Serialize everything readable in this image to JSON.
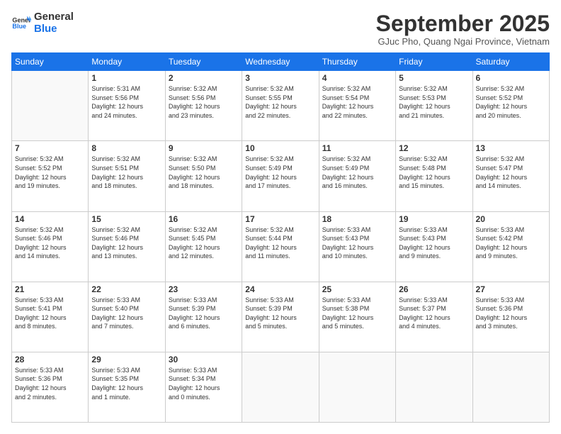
{
  "logo": {
    "general": "General",
    "blue": "Blue"
  },
  "header": {
    "month": "September 2025",
    "location": "GJuc Pho, Quang Ngai Province, Vietnam"
  },
  "weekdays": [
    "Sunday",
    "Monday",
    "Tuesday",
    "Wednesday",
    "Thursday",
    "Friday",
    "Saturday"
  ],
  "weeks": [
    [
      {
        "day": "",
        "info": ""
      },
      {
        "day": "1",
        "info": "Sunrise: 5:31 AM\nSunset: 5:56 PM\nDaylight: 12 hours\nand 24 minutes."
      },
      {
        "day": "2",
        "info": "Sunrise: 5:32 AM\nSunset: 5:56 PM\nDaylight: 12 hours\nand 23 minutes."
      },
      {
        "day": "3",
        "info": "Sunrise: 5:32 AM\nSunset: 5:55 PM\nDaylight: 12 hours\nand 22 minutes."
      },
      {
        "day": "4",
        "info": "Sunrise: 5:32 AM\nSunset: 5:54 PM\nDaylight: 12 hours\nand 22 minutes."
      },
      {
        "day": "5",
        "info": "Sunrise: 5:32 AM\nSunset: 5:53 PM\nDaylight: 12 hours\nand 21 minutes."
      },
      {
        "day": "6",
        "info": "Sunrise: 5:32 AM\nSunset: 5:52 PM\nDaylight: 12 hours\nand 20 minutes."
      }
    ],
    [
      {
        "day": "7",
        "info": "Sunrise: 5:32 AM\nSunset: 5:52 PM\nDaylight: 12 hours\nand 19 minutes."
      },
      {
        "day": "8",
        "info": "Sunrise: 5:32 AM\nSunset: 5:51 PM\nDaylight: 12 hours\nand 18 minutes."
      },
      {
        "day": "9",
        "info": "Sunrise: 5:32 AM\nSunset: 5:50 PM\nDaylight: 12 hours\nand 18 minutes."
      },
      {
        "day": "10",
        "info": "Sunrise: 5:32 AM\nSunset: 5:49 PM\nDaylight: 12 hours\nand 17 minutes."
      },
      {
        "day": "11",
        "info": "Sunrise: 5:32 AM\nSunset: 5:49 PM\nDaylight: 12 hours\nand 16 minutes."
      },
      {
        "day": "12",
        "info": "Sunrise: 5:32 AM\nSunset: 5:48 PM\nDaylight: 12 hours\nand 15 minutes."
      },
      {
        "day": "13",
        "info": "Sunrise: 5:32 AM\nSunset: 5:47 PM\nDaylight: 12 hours\nand 14 minutes."
      }
    ],
    [
      {
        "day": "14",
        "info": "Sunrise: 5:32 AM\nSunset: 5:46 PM\nDaylight: 12 hours\nand 14 minutes."
      },
      {
        "day": "15",
        "info": "Sunrise: 5:32 AM\nSunset: 5:46 PM\nDaylight: 12 hours\nand 13 minutes."
      },
      {
        "day": "16",
        "info": "Sunrise: 5:32 AM\nSunset: 5:45 PM\nDaylight: 12 hours\nand 12 minutes."
      },
      {
        "day": "17",
        "info": "Sunrise: 5:32 AM\nSunset: 5:44 PM\nDaylight: 12 hours\nand 11 minutes."
      },
      {
        "day": "18",
        "info": "Sunrise: 5:33 AM\nSunset: 5:43 PM\nDaylight: 12 hours\nand 10 minutes."
      },
      {
        "day": "19",
        "info": "Sunrise: 5:33 AM\nSunset: 5:43 PM\nDaylight: 12 hours\nand 9 minutes."
      },
      {
        "day": "20",
        "info": "Sunrise: 5:33 AM\nSunset: 5:42 PM\nDaylight: 12 hours\nand 9 minutes."
      }
    ],
    [
      {
        "day": "21",
        "info": "Sunrise: 5:33 AM\nSunset: 5:41 PM\nDaylight: 12 hours\nand 8 minutes."
      },
      {
        "day": "22",
        "info": "Sunrise: 5:33 AM\nSunset: 5:40 PM\nDaylight: 12 hours\nand 7 minutes."
      },
      {
        "day": "23",
        "info": "Sunrise: 5:33 AM\nSunset: 5:39 PM\nDaylight: 12 hours\nand 6 minutes."
      },
      {
        "day": "24",
        "info": "Sunrise: 5:33 AM\nSunset: 5:39 PM\nDaylight: 12 hours\nand 5 minutes."
      },
      {
        "day": "25",
        "info": "Sunrise: 5:33 AM\nSunset: 5:38 PM\nDaylight: 12 hours\nand 5 minutes."
      },
      {
        "day": "26",
        "info": "Sunrise: 5:33 AM\nSunset: 5:37 PM\nDaylight: 12 hours\nand 4 minutes."
      },
      {
        "day": "27",
        "info": "Sunrise: 5:33 AM\nSunset: 5:36 PM\nDaylight: 12 hours\nand 3 minutes."
      }
    ],
    [
      {
        "day": "28",
        "info": "Sunrise: 5:33 AM\nSunset: 5:36 PM\nDaylight: 12 hours\nand 2 minutes."
      },
      {
        "day": "29",
        "info": "Sunrise: 5:33 AM\nSunset: 5:35 PM\nDaylight: 12 hours\nand 1 minute."
      },
      {
        "day": "30",
        "info": "Sunrise: 5:33 AM\nSunset: 5:34 PM\nDaylight: 12 hours\nand 0 minutes."
      },
      {
        "day": "",
        "info": ""
      },
      {
        "day": "",
        "info": ""
      },
      {
        "day": "",
        "info": ""
      },
      {
        "day": "",
        "info": ""
      }
    ]
  ]
}
